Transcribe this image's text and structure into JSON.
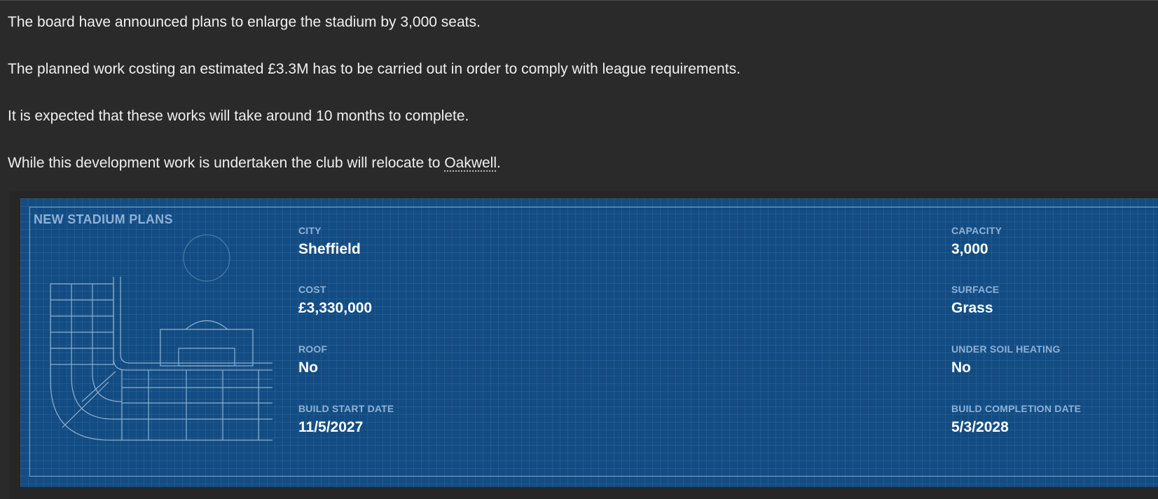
{
  "message": {
    "paragraphs": [
      "The board have announced plans to enlarge the stadium by 3,000 seats.",
      "The planned work costing an estimated £3.3M has to be carried out in order to comply with league requirements.",
      "It is expected that these works will take around 10 months to complete."
    ],
    "relocation": {
      "before": "While this development work is undertaken the club will relocate to ",
      "stadium_link": "Oakwell",
      "after": "."
    }
  },
  "stadium_plans": {
    "title": "NEW STADIUM PLANS",
    "fields": {
      "city": {
        "label": "CITY",
        "value": "Sheffield"
      },
      "capacity": {
        "label": "CAPACITY",
        "value": "3,000"
      },
      "cost": {
        "label": "COST",
        "value": "£3,330,000"
      },
      "surface": {
        "label": "SURFACE",
        "value": "Grass"
      },
      "roof": {
        "label": "ROOF",
        "value": "No"
      },
      "under_soil_heating": {
        "label": "UNDER SOIL HEATING",
        "value": "No"
      },
      "build_start_date": {
        "label": "BUILD START DATE",
        "value": "11/5/2027"
      },
      "build_completion_date": {
        "label": "BUILD COMPLETION DATE",
        "value": "5/3/2028"
      }
    }
  },
  "colors": {
    "background": "#2a2a2a",
    "blueprint": "#124c82",
    "label": "#8fb1d6",
    "value": "#ffffff"
  }
}
